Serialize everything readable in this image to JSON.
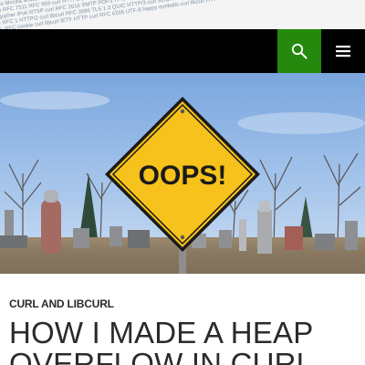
{
  "header": {
    "search_icon": "search-icon",
    "menu_icon": "hamburger-menu-icon",
    "accent_color": "#24890d",
    "bar_color": "#000000"
  },
  "featured_image": {
    "sign_text": "OOPS!",
    "sign_color": "#f6c21b"
  },
  "entry": {
    "category": "CURL AND LIBCURL",
    "title_line_1": "HOW I MADE A HEAP",
    "title_line_2": "OVERFLOW IN CURL"
  }
}
